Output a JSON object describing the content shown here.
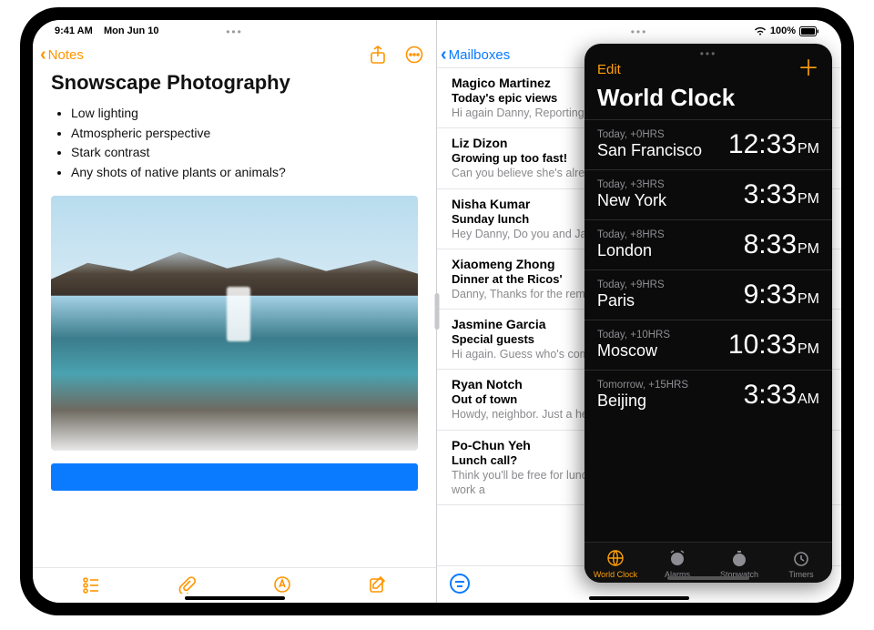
{
  "statusbar": {
    "time": "9:41 AM",
    "date": "Mon Jun 10",
    "battery": "100%"
  },
  "notes": {
    "back_label": "Notes",
    "title": "Snowscape Photography",
    "bullets": [
      "Low lighting",
      "Atmospheric perspective",
      "Stark contrast",
      "Any shots of native plants or animals?"
    ]
  },
  "mail": {
    "back_label": "Mailboxes",
    "items": [
      {
        "sender": "Magico Martinez",
        "subject": "Today's epic views",
        "preview": "Hi again Danny, Reporting from the deep North! Wide open skies, a ge"
      },
      {
        "sender": "Liz Dizon",
        "subject": "Growing up too fast!",
        "preview": "Can you believe she's already…"
      },
      {
        "sender": "Nisha Kumar",
        "subject": "Sunday lunch",
        "preview": "Hey Danny, Do you and Jane want to come by Sunday? If you two join, th"
      },
      {
        "sender": "Xiaomeng Zhong",
        "subject": "Dinner at the Ricos'",
        "preview": "Danny, Thanks for the reminder — I almost forgot! I remembered to take o"
      },
      {
        "sender": "Jasmine Garcia",
        "subject": "Special guests",
        "preview": "Hi again. Guess who's coming to town? You know how to make me"
      },
      {
        "sender": "Ryan Notch",
        "subject": "Out of town",
        "preview": "Howdy, neighbor. Just a heads up — we're leaving Tuesday and wor"
      },
      {
        "sender": "Po-Chun Yeh",
        "subject": "Lunch call?",
        "preview": "Think you'll be free for lunch today? Let me know what you think might work a"
      }
    ]
  },
  "clock": {
    "edit_label": "Edit",
    "title": "World Clock",
    "rows": [
      {
        "offset": "Today, +0HRS",
        "city": "San Francisco",
        "time": "12:33",
        "ampm": "PM"
      },
      {
        "offset": "Today, +3HRS",
        "city": "New York",
        "time": "3:33",
        "ampm": "PM"
      },
      {
        "offset": "Today, +8HRS",
        "city": "London",
        "time": "8:33",
        "ampm": "PM"
      },
      {
        "offset": "Today, +9HRS",
        "city": "Paris",
        "time": "9:33",
        "ampm": "PM"
      },
      {
        "offset": "Today, +10HRS",
        "city": "Moscow",
        "time": "10:33",
        "ampm": "PM"
      },
      {
        "offset": "Tomorrow, +15HRS",
        "city": "Beijing",
        "time": "3:33",
        "ampm": "AM"
      }
    ],
    "tabs": [
      {
        "label": "World Clock",
        "active": true
      },
      {
        "label": "Alarms",
        "active": false
      },
      {
        "label": "Stopwatch",
        "active": false
      },
      {
        "label": "Timers",
        "active": false
      }
    ]
  }
}
